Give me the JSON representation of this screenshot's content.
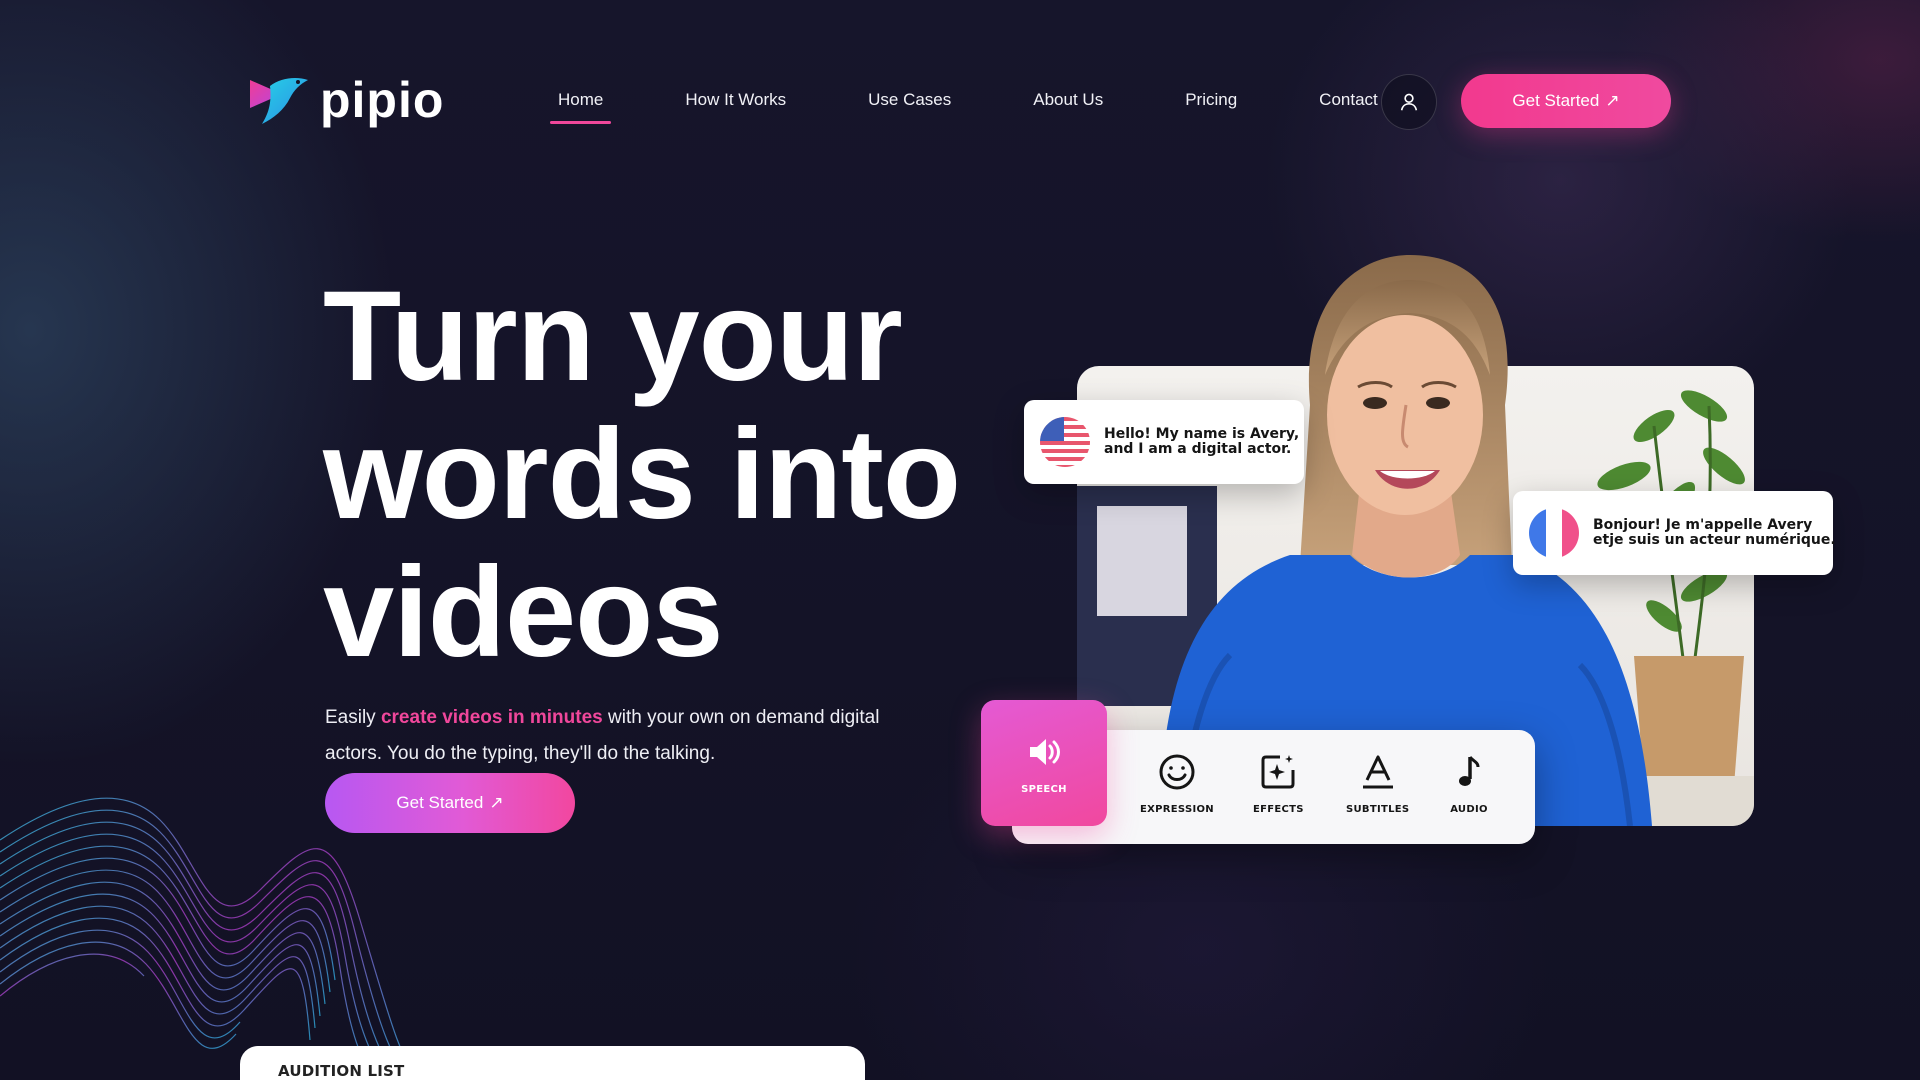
{
  "brand": {
    "name": "pipio",
    "accent": "#f0479b",
    "accent_gradient": [
      "#b758f2",
      "#f2479f"
    ]
  },
  "nav": {
    "items": [
      {
        "label": "Home",
        "active": true
      },
      {
        "label": "How It Works",
        "active": false
      },
      {
        "label": "Use Cases",
        "active": false
      },
      {
        "label": "About Us",
        "active": false
      },
      {
        "label": "Pricing",
        "active": false
      },
      {
        "label": "Contact",
        "active": false
      }
    ],
    "user_icon": "user-icon",
    "cta_label": "Get Started",
    "cta_icon": "↗"
  },
  "hero": {
    "title_lines": [
      "Turn your",
      "words into",
      "videos"
    ],
    "subtitle_before": "Easily ",
    "subtitle_highlight": "create videos in minutes",
    "subtitle_after": " with your own on demand digital actors. You do the typing, they'll do the talking.",
    "cta_label": "Get Started",
    "cta_icon": "↗"
  },
  "demo": {
    "bubble_en": {
      "flag": "us-flag-icon",
      "line1": "Hello! My name is Avery,",
      "line2": "and I am a digital actor."
    },
    "bubble_fr": {
      "flag": "fr-flag-icon",
      "line1": "Bonjour! Je m'appelle Avery",
      "line2": "etje suis un acteur numérique."
    },
    "tools": [
      {
        "label": "SPEECH",
        "icon": "speaker-icon",
        "active": true
      },
      {
        "label": "EXPRESSION",
        "icon": "smiley-icon",
        "active": false
      },
      {
        "label": "EFFECTS",
        "icon": "sparkle-icon",
        "active": false
      },
      {
        "label": "SUBTITLES",
        "icon": "text-underline-icon",
        "active": false
      },
      {
        "label": "AUDIO",
        "icon": "music-note-icon",
        "active": false
      }
    ]
  },
  "audition": {
    "title": "AUDITION LIST"
  }
}
